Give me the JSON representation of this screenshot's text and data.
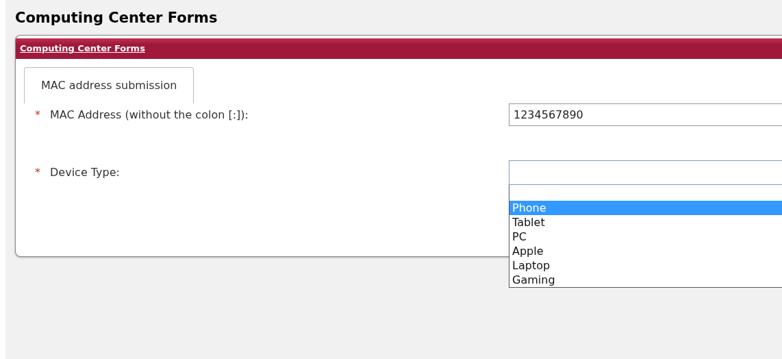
{
  "page_title": "Computing Center Forms",
  "panel": {
    "title": "Computing Center Forms",
    "tabs": [
      {
        "label": "MAC address submission",
        "selected": true
      }
    ],
    "fields": [
      {
        "marker": "*",
        "label": "MAC Address (without the colon [:]):",
        "kind": "text",
        "value": "1234567890"
      },
      {
        "marker": "*",
        "label": "Device Type:",
        "kind": "select",
        "expanded": true,
        "options": [
          {
            "label": "Phone",
            "selected": true
          },
          {
            "label": "Tablet",
            "selected": false
          },
          {
            "label": "PC",
            "selected": false
          },
          {
            "label": "Apple",
            "selected": false
          },
          {
            "label": "Laptop",
            "selected": false
          },
          {
            "label": "Gaming",
            "selected": false
          }
        ]
      }
    ]
  }
}
